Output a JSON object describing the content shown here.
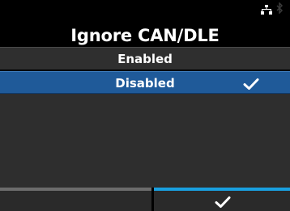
{
  "status_bar": {
    "icons": [
      "network-icon",
      "bluetooth-icon"
    ]
  },
  "title": "Ignore CAN/DLE",
  "options": [
    {
      "label": "Enabled",
      "selected": false
    },
    {
      "label": "Disabled",
      "selected": true
    }
  ],
  "footer": {
    "left_button_icon": "",
    "right_button_icon": "check-icon",
    "confirm_accent": "#19a0e0"
  },
  "colors": {
    "background": "#000000",
    "selected_row": "#1f5a99",
    "unselected_row": "#2f2f2f"
  }
}
